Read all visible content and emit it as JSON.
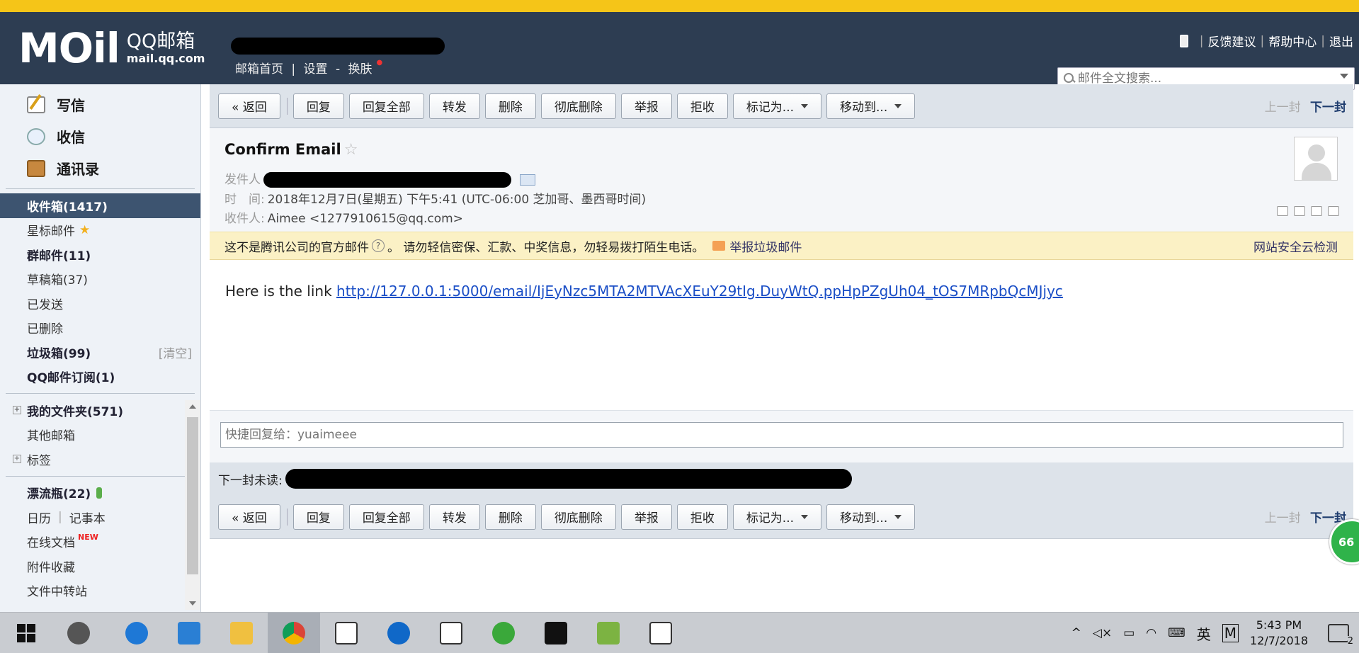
{
  "header": {
    "logo_main": "MOil",
    "logo_cn": "QQ邮箱",
    "logo_url": "mail.qq.com",
    "links": [
      "邮箱首页",
      "|",
      "设置",
      "-",
      "换肤"
    ],
    "top_right": [
      "反馈建议",
      "帮助中心",
      "退出"
    ],
    "search_placeholder": "邮件全文搜索..."
  },
  "sidebar": {
    "actions": [
      "写信",
      "收信",
      "通讯录"
    ],
    "folders": [
      {
        "label": "收件箱(1417)"
      },
      {
        "label": "星标邮件"
      },
      {
        "label": "群邮件(11)"
      },
      {
        "label": "草稿箱(37)"
      },
      {
        "label": "已发送"
      },
      {
        "label": "已删除"
      },
      {
        "label": "垃圾箱(99)",
        "extra": "[清空]"
      },
      {
        "label": "QQ邮件订阅(1)"
      },
      {
        "label": "我的文件夹(571)"
      },
      {
        "label": "其他邮箱"
      },
      {
        "label": "标签"
      },
      {
        "label": "漂流瓶(22)"
      },
      {
        "label": "日历",
        "extra2": "记事本"
      },
      {
        "label": "在线文档",
        "badge": "NEW"
      },
      {
        "label": "附件收藏"
      },
      {
        "label": "文件中转站"
      }
    ]
  },
  "toolbar": {
    "back": "« 返回",
    "buttons": [
      "回复",
      "回复全部",
      "转发",
      "删除",
      "彻底删除",
      "举报",
      "拒收",
      "标记为...",
      "移动到..."
    ],
    "prev": "上一封",
    "next": "下一封"
  },
  "mail": {
    "subject": "Confirm Email",
    "sender_label": "发件人",
    "time_label": "时　间:",
    "time_value": "2018年12月7日(星期五) 下午5:41 (UTC-06:00 芝加哥、墨西哥时间)",
    "to_label": "收件人:",
    "to_value": "Aimee <1277910615@qq.com>",
    "warning": "这不是腾讯公司的官方邮件",
    "warning2": "。 请勿轻信密保、汇款、中奖信息，勿轻易拨打陌生电话。",
    "report_spam": "举报垃圾邮件",
    "safety_check": "网站安全云检测",
    "body_prefix": "Here is the link ",
    "body_link": "http://127.0.0.1:5000/email/IjEyNzc5MTA2MTVAcXEuY29tIg.DuyWtQ.ppHpPZgUh04_tOS7MRpbQcMJjyc",
    "quick_reply_placeholder": "快捷回复给：yuaimeee",
    "next_unread_label": "下一封未读:",
    "badge_value": "66"
  },
  "taskbar": {
    "ime": "英",
    "ime2": "M",
    "time": "5:43 PM",
    "date": "12/7/2018",
    "notifications": "2"
  }
}
